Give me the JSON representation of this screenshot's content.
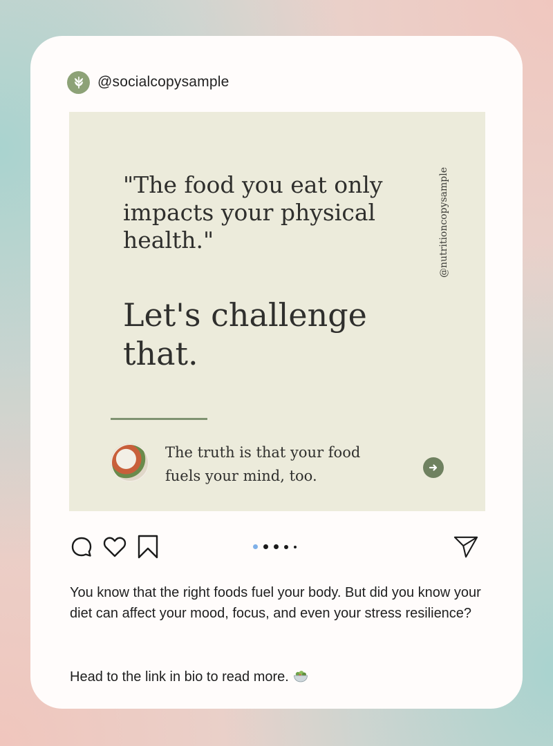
{
  "post": {
    "handle": "@socialcopysample",
    "quote": "\"The food you eat only impacts your physical health.\"",
    "headline": "Let's challenge that.",
    "vertical_handle": "@nutritioncopysample",
    "truth": "The truth is that your food fuels your mind, too."
  },
  "carousel": {
    "count": 5,
    "active_index": 0,
    "active_color": "#7fb0e8"
  },
  "caption": {
    "line1": "You know that the right foods fuel your body. But did you know your diet can affect your mood, focus, and even your stress resilience?",
    "line2": "Head to the link in bio to read more."
  },
  "colors": {
    "accent_green": "#7f9271",
    "post_background": "#ecebdb",
    "card_background": "#fffcfb"
  },
  "icons": [
    "leaf-logo-icon",
    "comment-icon",
    "heart-icon",
    "bookmark-icon",
    "send-icon",
    "arrow-right-icon",
    "salad-bowl-icon"
  ]
}
